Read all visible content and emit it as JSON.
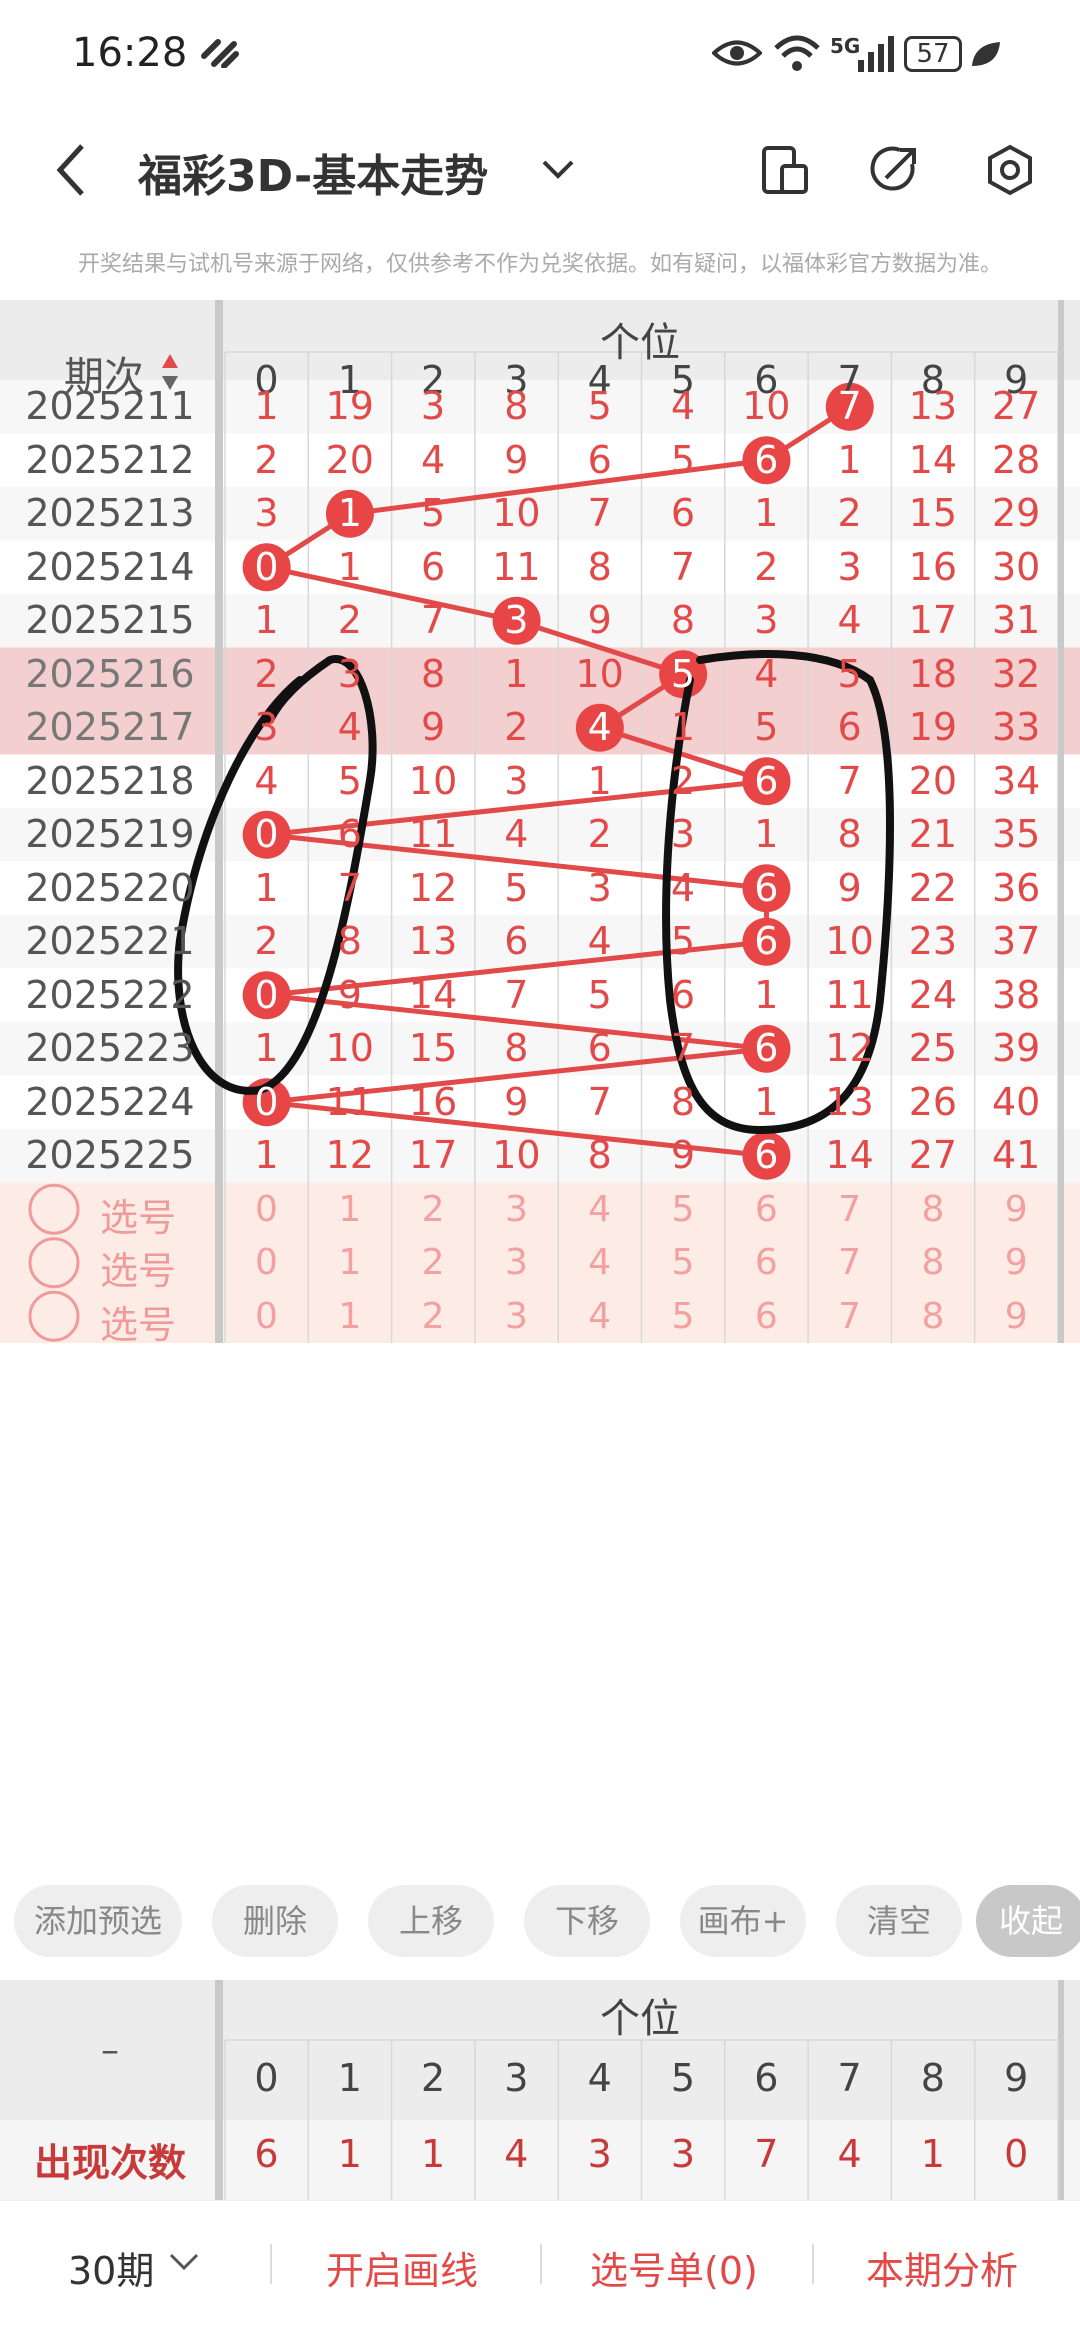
{
  "status": {
    "time": "16:28",
    "network": "5G",
    "battery": "57"
  },
  "header": {
    "title": "福彩3D-基本走势",
    "notice": "开奖结果与试机号来源于网络，仅供参考不作为兑奖依据。如有疑问，以福体彩官方数据为准。"
  },
  "table": {
    "period_header": "期次",
    "group_header": "个位",
    "digits": [
      "0",
      "1",
      "2",
      "3",
      "4",
      "5",
      "6",
      "7",
      "8",
      "9"
    ],
    "rows": [
      {
        "period": "2025211",
        "cells": [
          "1",
          "19",
          "3",
          "8",
          "5",
          "4",
          "10",
          "7",
          "13",
          "27"
        ],
        "hit": 7
      },
      {
        "period": "2025212",
        "cells": [
          "2",
          "20",
          "4",
          "9",
          "6",
          "5",
          "6",
          "1",
          "14",
          "28"
        ],
        "hit": 6
      },
      {
        "period": "2025213",
        "cells": [
          "3",
          "1",
          "5",
          "10",
          "7",
          "6",
          "1",
          "2",
          "15",
          "29"
        ],
        "hit": 1
      },
      {
        "period": "2025214",
        "cells": [
          "0",
          "1",
          "6",
          "11",
          "8",
          "7",
          "2",
          "3",
          "16",
          "30"
        ],
        "hit": 0
      },
      {
        "period": "2025215",
        "cells": [
          "1",
          "2",
          "7",
          "3",
          "9",
          "8",
          "3",
          "4",
          "17",
          "31"
        ],
        "hit": 3
      },
      {
        "period": "2025216",
        "cells": [
          "2",
          "3",
          "8",
          "1",
          "10",
          "5",
          "4",
          "5",
          "18",
          "32"
        ],
        "hit": 5
      },
      {
        "period": "2025217",
        "cells": [
          "3",
          "4",
          "9",
          "2",
          "4",
          "1",
          "5",
          "6",
          "19",
          "33"
        ],
        "hit": 4
      },
      {
        "period": "2025218",
        "cells": [
          "4",
          "5",
          "10",
          "3",
          "1",
          "2",
          "6",
          "7",
          "20",
          "34"
        ],
        "hit": 6
      },
      {
        "period": "2025219",
        "cells": [
          "0",
          "6",
          "11",
          "4",
          "2",
          "3",
          "1",
          "8",
          "21",
          "35"
        ],
        "hit": 0
      },
      {
        "period": "2025220",
        "cells": [
          "1",
          "7",
          "12",
          "5",
          "3",
          "4",
          "6",
          "9",
          "22",
          "36"
        ],
        "hit": 6
      },
      {
        "period": "2025221",
        "cells": [
          "2",
          "8",
          "13",
          "6",
          "4",
          "5",
          "6",
          "10",
          "23",
          "37"
        ],
        "hit": 6
      },
      {
        "period": "2025222",
        "cells": [
          "0",
          "9",
          "14",
          "7",
          "5",
          "6",
          "1",
          "11",
          "24",
          "38"
        ],
        "hit": 0
      },
      {
        "period": "2025223",
        "cells": [
          "1",
          "10",
          "15",
          "8",
          "6",
          "7",
          "6",
          "12",
          "25",
          "39"
        ],
        "hit": 6
      },
      {
        "period": "2025224",
        "cells": [
          "0",
          "11",
          "16",
          "9",
          "7",
          "8",
          "1",
          "13",
          "26",
          "40"
        ],
        "hit": 0
      },
      {
        "period": "2025225",
        "cells": [
          "1",
          "12",
          "17",
          "10",
          "8",
          "9",
          "6",
          "14",
          "27",
          "41"
        ],
        "hit": 6
      }
    ],
    "pick_label": "选号",
    "pick_rows": 3
  },
  "toolbar": {
    "add": "添加预选",
    "delete": "删除",
    "up": "上移",
    "down": "下移",
    "canvas": "画布+",
    "clear": "清空",
    "collapse": "收起"
  },
  "stats": {
    "dash": "–",
    "group_header": "个位",
    "label": "出现次数",
    "counts": [
      "6",
      "1",
      "1",
      "4",
      "3",
      "3",
      "7",
      "4",
      "1",
      "0"
    ]
  },
  "bottom": {
    "periods": "30期",
    "draw": "开启画线",
    "picklist": "选号单(0)",
    "analysis": "本期分析"
  },
  "colors": {
    "accent": "#e24a4a",
    "highlight_row": "#f6d3d3",
    "pick_bg": "#fdece6"
  }
}
